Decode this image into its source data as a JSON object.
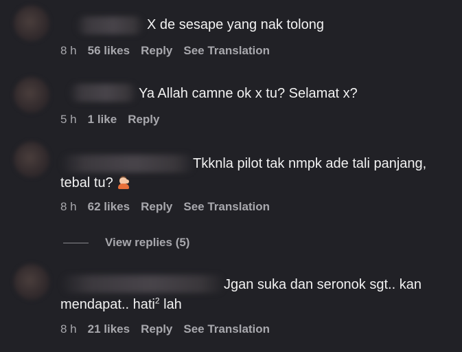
{
  "comments": [
    {
      "text": "X de sesape yang nak tolong",
      "time": "8 h",
      "likes": "56 likes",
      "reply": "Reply",
      "translate": "See Translation"
    },
    {
      "text": "Ya Allah camne ok x tu? Selamat x?",
      "time": "5 h",
      "likes": "1 like",
      "reply": "Reply"
    },
    {
      "text_line1": "Tkknla pilot tak nmpk ade tali panjang,",
      "text_line2": "tebal tu?",
      "emoji": "person-tipping-hand-icon",
      "time": "8 h",
      "likes": "62 likes",
      "reply": "Reply",
      "translate": "See Translation",
      "view_replies": "View replies (5)"
    },
    {
      "text_line1": "Jgan suka dan seronok sgt.. kan",
      "text_line2_a": "mendapat.. hati",
      "text_line2_sup": "2",
      "text_line2_b": " lah",
      "time": "8 h",
      "likes": "21 likes",
      "reply": "Reply",
      "translate": "See Translation"
    }
  ],
  "colors": {
    "background": "#212126",
    "text": "#f2f2f2",
    "meta": "#a8a8ad"
  }
}
